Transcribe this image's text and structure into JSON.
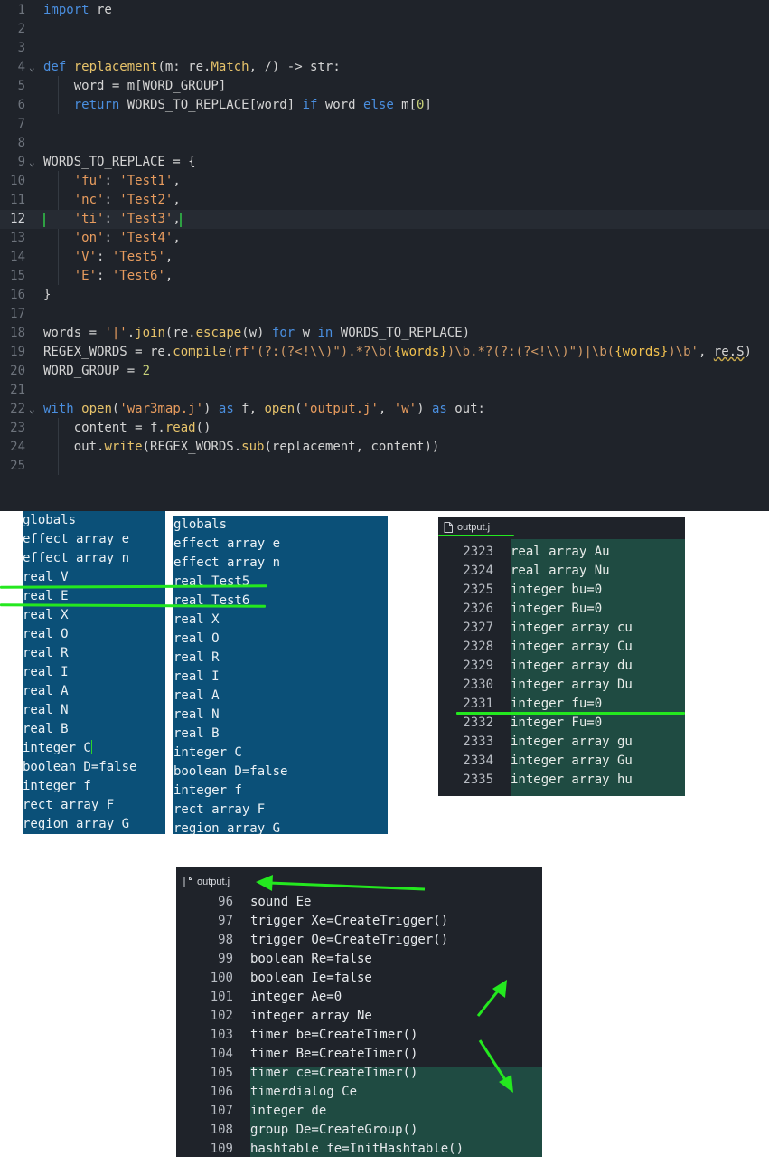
{
  "editor": {
    "current_line": 12,
    "lines": [
      {
        "n": "1"
      },
      {
        "n": "2"
      },
      {
        "n": "3"
      },
      {
        "n": "4"
      },
      {
        "n": "5"
      },
      {
        "n": "6"
      },
      {
        "n": "7"
      },
      {
        "n": "8"
      },
      {
        "n": "9"
      },
      {
        "n": "10"
      },
      {
        "n": "11"
      },
      {
        "n": "12"
      },
      {
        "n": "13"
      },
      {
        "n": "14"
      },
      {
        "n": "15"
      },
      {
        "n": "16"
      },
      {
        "n": "17"
      },
      {
        "n": "18"
      },
      {
        "n": "19"
      },
      {
        "n": "20"
      },
      {
        "n": "21"
      },
      {
        "n": "22"
      },
      {
        "n": "23"
      },
      {
        "n": "24"
      },
      {
        "n": "25"
      }
    ],
    "code": {
      "l1_import": "import",
      "l1_mod": " re",
      "l4_def": "def",
      "l4_fn": "replacement",
      "l4_rest": "(m: re.",
      "l4_match": "Match",
      "l4_tail": ", /) -> str:",
      "l5": "word = m[WORD_GROUP]",
      "l6_return": "return",
      "l6_mid": " WORDS_TO_REPLACE[word] ",
      "l6_if": "if",
      "l6_word": " word ",
      "l6_else": "else",
      "l6_m": " m[",
      "l6_zero": "0",
      "l6_close": "]",
      "l9": "WORDS_TO_REPLACE = {",
      "dict": [
        {
          "k": "'fu'",
          "v": "'Test1'"
        },
        {
          "k": "'nc'",
          "v": "'Test2'"
        },
        {
          "k": "'ti'",
          "v": "'Test3'"
        },
        {
          "k": "'on'",
          "v": "'Test4'"
        },
        {
          "k": "'V'",
          "v": "'Test5'"
        },
        {
          "k": "'E'",
          "v": "'Test6'"
        }
      ],
      "l16": "}",
      "l18_a": "words = ",
      "l18_str": "'|'",
      "l18_b": ".",
      "l18_join": "join",
      "l18_c": "(re.",
      "l18_escape": "escape",
      "l18_d": "(w) ",
      "l18_for": "for",
      "l18_e": " w ",
      "l18_in": "in",
      "l18_f": " WORDS_TO_REPLACE)",
      "l19_a": "REGEX_WORDS = re.",
      "l19_compile": "compile",
      "l19_b": "(",
      "l19_rf": "rf'",
      "l19_rx1": "(?:(?<!\\\\)\").*?\\b(",
      "l19_words1": "{words}",
      "l19_rx2": ")\\b.*?(?:(?<!\\\\)\")|\\b(",
      "l19_words2": "{words}",
      "l19_rx3": ")\\b'",
      "l19_c": ", ",
      "l19_flag": "re.S",
      "l19_d": ")",
      "l20_a": "WORD_GROUP = ",
      "l20_num": "2",
      "l22_with": "with",
      "l22_a": " ",
      "l22_open": "open",
      "l22_b": "(",
      "l22_s1": "'war3map.j'",
      "l22_c": ") ",
      "l22_as": "as",
      "l22_d": " f, ",
      "l22_open2": "open",
      "l22_e": "(",
      "l22_s2": "'output.j'",
      "l22_f": ", ",
      "l22_s3": "'w'",
      "l22_g": ") ",
      "l22_as2": "as",
      "l22_h": " out:",
      "l23_a": "content = f.",
      "l23_read": "read",
      "l23_b": "()",
      "l24_a": "out.",
      "l24_write": "write",
      "l24_b": "(REGEX_WORDS.",
      "l24_sub": "sub",
      "l24_c": "(replacement, content))"
    }
  },
  "left_panel": {
    "lines": [
      "globals",
      "effect array e",
      "effect array n",
      "real V",
      "real E",
      "real X",
      "real O",
      "real R",
      "real I",
      "real A",
      "real N",
      "real B",
      "integer C",
      "boolean D=false",
      "integer f",
      "rect array F",
      "region array G"
    ]
  },
  "mid_panel": {
    "lines": [
      "globals",
      "effect array e",
      "effect array n",
      "real Test5",
      "real Test6",
      "real X",
      "real O",
      "real R",
      "real I",
      "real A",
      "real N",
      "real B",
      "integer C",
      "boolean D=false",
      "integer f",
      "rect array F",
      "region array G"
    ]
  },
  "right_panel": {
    "tab_label": "output.j",
    "rows": [
      {
        "n": "2323",
        "t": "real array Au"
      },
      {
        "n": "2324",
        "t": "real array Nu"
      },
      {
        "n": "2325",
        "t": "integer bu=0"
      },
      {
        "n": "2326",
        "t": "integer Bu=0"
      },
      {
        "n": "2327",
        "t": "integer array cu"
      },
      {
        "n": "2328",
        "t": "integer array Cu"
      },
      {
        "n": "2329",
        "t": "integer array du"
      },
      {
        "n": "2330",
        "t": "integer array Du"
      },
      {
        "n": "2331",
        "t": "integer fu=0"
      },
      {
        "n": "2332",
        "t": "integer Fu=0"
      },
      {
        "n": "2333",
        "t": "integer array gu"
      },
      {
        "n": "2334",
        "t": "integer array Gu"
      },
      {
        "n": "2335",
        "t": "integer array hu"
      }
    ]
  },
  "bottom_panel": {
    "tab_label": "output.j",
    "rows": [
      {
        "n": "96",
        "t": "sound Ee"
      },
      {
        "n": "97",
        "t": "trigger Xe=CreateTrigger()"
      },
      {
        "n": "98",
        "t": "trigger Oe=CreateTrigger()"
      },
      {
        "n": "99",
        "t": "boolean Re=false"
      },
      {
        "n": "100",
        "t": "boolean Ie=false"
      },
      {
        "n": "101",
        "t": "integer Ae=0"
      },
      {
        "n": "102",
        "t": "integer array Ne"
      },
      {
        "n": "103",
        "t": "timer be=CreateTimer()"
      },
      {
        "n": "104",
        "t": "timer Be=CreateTimer()"
      },
      {
        "n": "105",
        "t": "timer ce=CreateTimer()"
      },
      {
        "n": "106",
        "t": "timerdialog Ce"
      },
      {
        "n": "107",
        "t": "integer de"
      },
      {
        "n": "108",
        "t": "group De=CreateGroup()"
      },
      {
        "n": "109",
        "t": "hashtable fe=InitHashtable()"
      }
    ]
  },
  "colors": {
    "editor_bg": "#1f232a",
    "selection_blue": "#0b5078",
    "selection_green": "#1f4b42",
    "annotation_green": "#24e81f",
    "keyword": "#4a8fe0",
    "function": "#e7c36a",
    "string": "#e89c5e"
  }
}
